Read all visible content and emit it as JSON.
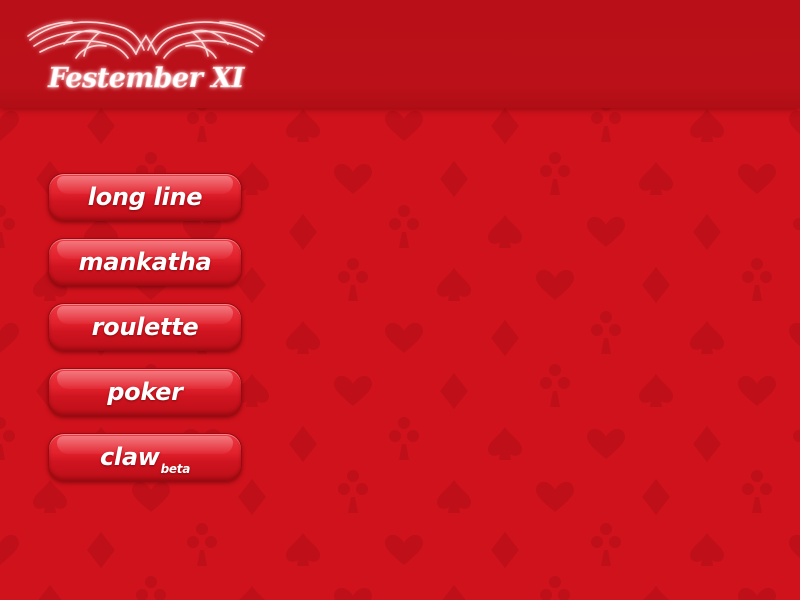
{
  "app": {
    "logo_text": "Festember XI"
  },
  "menu": {
    "items": [
      {
        "label": "long line",
        "suffix": ""
      },
      {
        "label": "mankatha",
        "suffix": ""
      },
      {
        "label": "roulette",
        "suffix": ""
      },
      {
        "label": "poker",
        "suffix": ""
      },
      {
        "label": "claw",
        "suffix": "beta"
      }
    ]
  },
  "theme": {
    "background": "#d0121c",
    "header": "#b80f18",
    "pattern": "#bf0f19",
    "button": "#e2222d",
    "text": "#ffffff"
  },
  "icons": {
    "pattern": [
      "club-icon",
      "spade-icon",
      "heart-icon",
      "diamond-icon"
    ],
    "logo_ornament": "winged-ornament-icon"
  }
}
